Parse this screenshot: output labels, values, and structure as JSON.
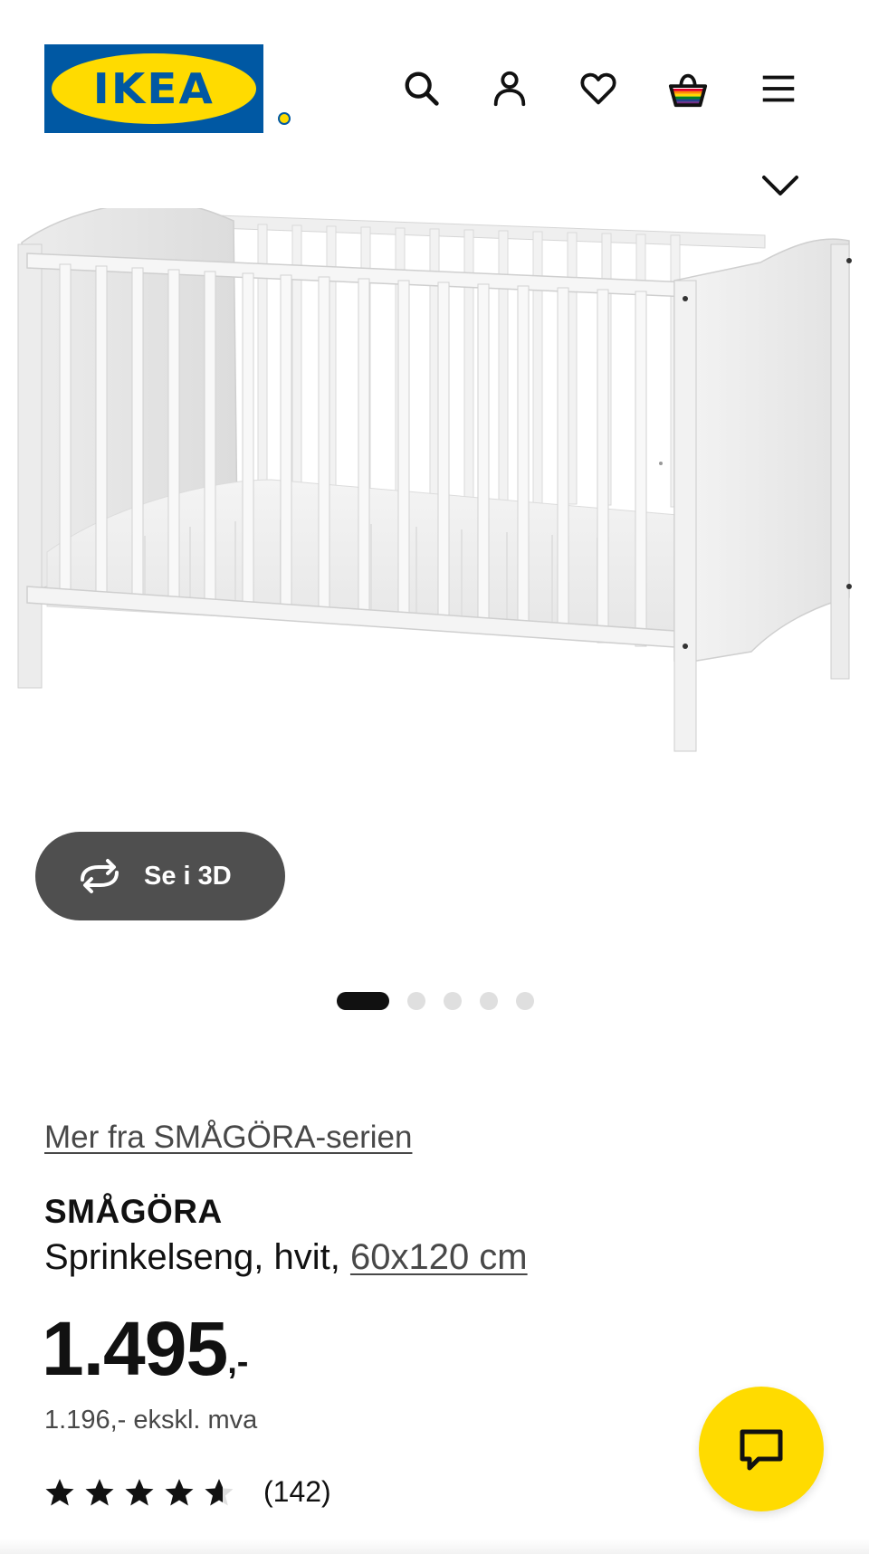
{
  "header": {
    "logo_text": "IKEA",
    "icons": [
      "search-icon",
      "account-icon",
      "heart-icon",
      "basket-icon",
      "menu-icon"
    ],
    "brand_colors": {
      "blue": "#0058a3",
      "yellow": "#ffdb00"
    }
  },
  "gallery": {
    "view3d_label": "Se i 3D",
    "dot_count": 5,
    "active_dot": 1
  },
  "product": {
    "series_link": "Mer fra SMÅGÖRA-serien",
    "name": "SMÅGÖRA",
    "description": "Sprinkelseng, hvit, ",
    "size_link": "60x120 cm",
    "price_main": "1.495",
    "price_suffix": ",-",
    "price_ex_vat": "1.196,- ekskl. mva",
    "rating_stars": 4.5,
    "review_count": "(142)"
  },
  "chat": {
    "icon": "chat-icon",
    "color": "#ffdb00"
  }
}
